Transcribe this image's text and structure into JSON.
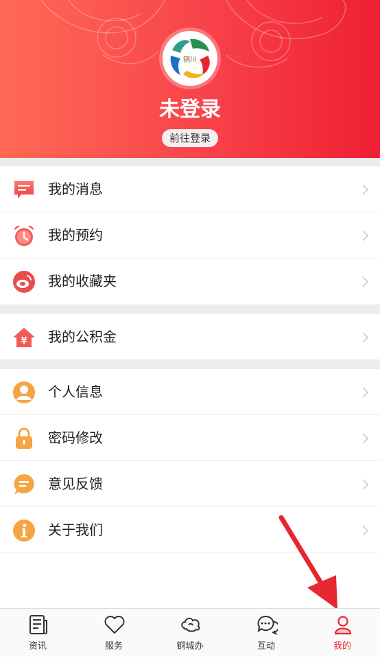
{
  "header": {
    "title": "未登录",
    "login_label": "前往登录",
    "logo_text": "铜川"
  },
  "menu_groups": [
    {
      "items": [
        {
          "label": "我的消息",
          "icon": "message-icon"
        },
        {
          "label": "我的预约",
          "icon": "alarm-clock-icon"
        },
        {
          "label": "我的收藏夹",
          "icon": "weibo-icon"
        }
      ]
    },
    {
      "items": [
        {
          "label": "我的公积金",
          "icon": "house-yuan-icon"
        }
      ]
    },
    {
      "items": [
        {
          "label": "个人信息",
          "icon": "person-icon"
        },
        {
          "label": "密码修改",
          "icon": "lock-icon"
        },
        {
          "label": "意见反馈",
          "icon": "feedback-icon"
        },
        {
          "label": "关于我们",
          "icon": "info-icon"
        }
      ]
    }
  ],
  "tabbar": {
    "items": [
      {
        "label": "资讯",
        "icon": "news-icon"
      },
      {
        "label": "服务",
        "icon": "heart-icon"
      },
      {
        "label": "铜城办",
        "icon": "cloud-icon"
      },
      {
        "label": "互动",
        "icon": "chat-icon"
      },
      {
        "label": "我的",
        "icon": "profile-icon"
      }
    ],
    "active_index": 4,
    "active_color": "#e8262f"
  },
  "colors": {
    "header_start": "#ff6a55",
    "header_end": "#ef1f33",
    "annotation_arrow": "#e8262f"
  }
}
